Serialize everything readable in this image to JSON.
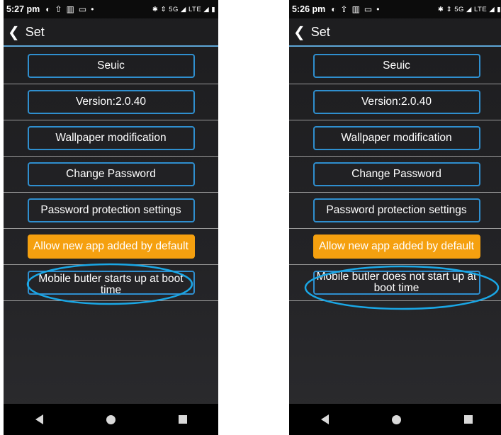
{
  "screens": [
    {
      "status": {
        "time": "5:27 pm",
        "right_icons": "✱ ⇕ 5G ◢ LTE ◢ ▮"
      },
      "appbar": {
        "back_icon": "chevron-left-icon",
        "title": "Set"
      },
      "buttons": [
        "Seuic",
        "Version:2.0.40",
        "Wallpaper modification",
        "Change Password",
        "Password protection settings",
        "Allow new app added by default",
        "Mobile butler starts up at boot time"
      ]
    },
    {
      "status": {
        "time": "5:26 pm",
        "right_icons": "✱ ⇕ 5G ◢ LTE ◢ ▮"
      },
      "appbar": {
        "back_icon": "chevron-left-icon",
        "title": "Set"
      },
      "buttons": [
        "Seuic",
        "Version:2.0.40",
        "Wallpaper modification",
        "Change Password",
        "Password protection settings",
        "Allow new app added by default",
        "Mobile butler does not start up at boot time"
      ]
    }
  ],
  "colors": {
    "accent_border": "#2f8fcf",
    "highlight": "#f5a00f",
    "annotation": "#1aa7e6"
  }
}
